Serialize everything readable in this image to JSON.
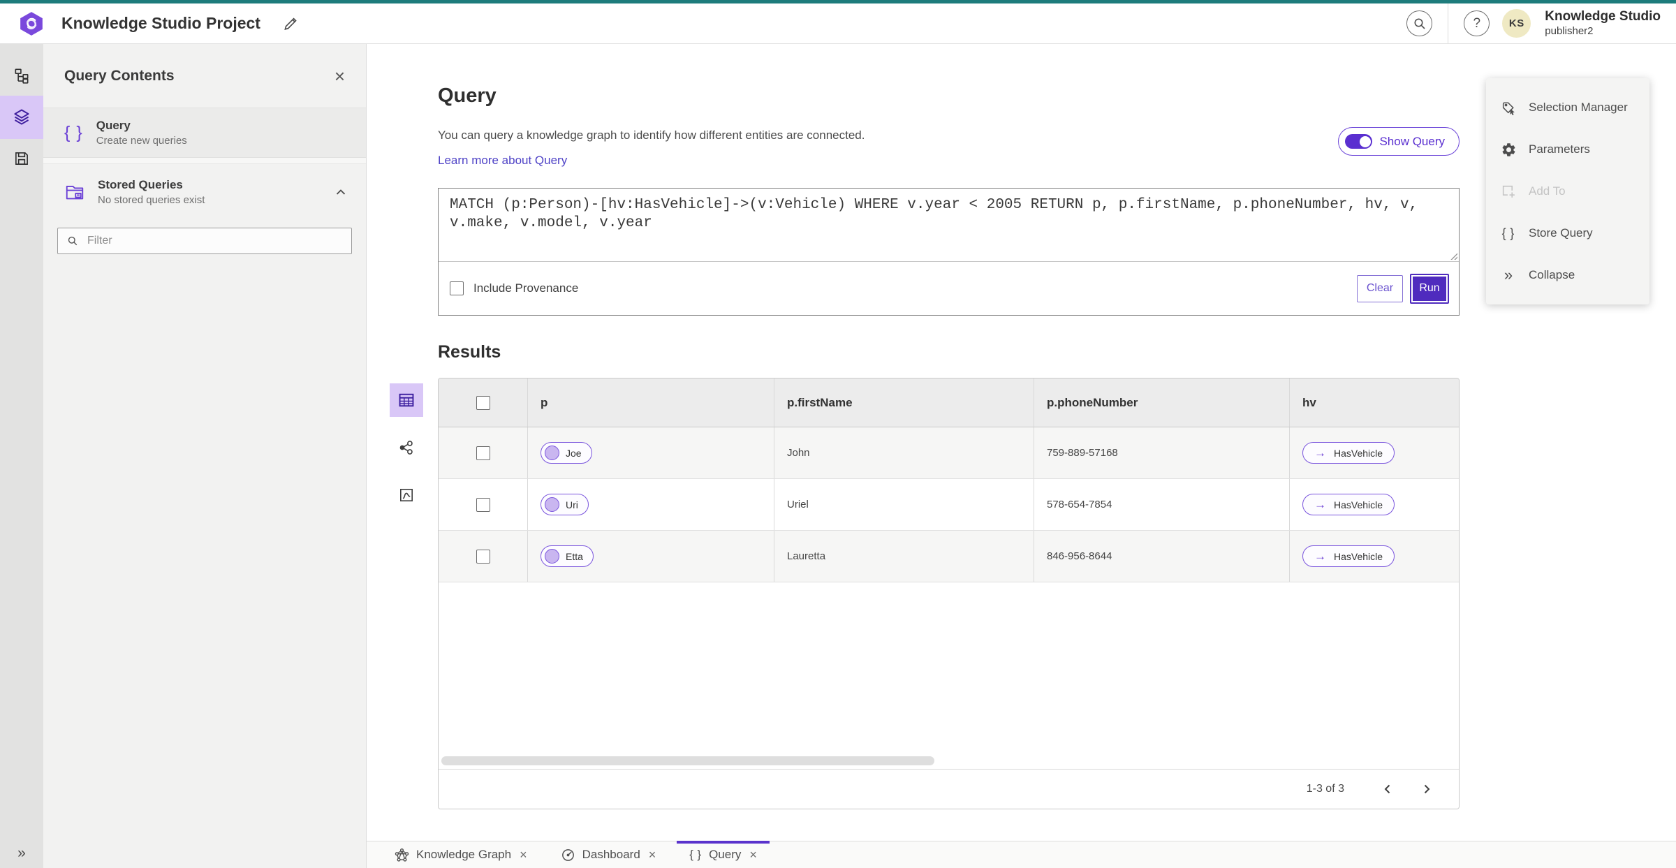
{
  "app": {
    "title": "Knowledge Studio Project",
    "avatar_initials": "KS",
    "account_name": "Knowledge Studio",
    "account_user": "publisher2"
  },
  "colors": {
    "top_accent": "#1e7c7c",
    "primary_purple": "#5a2fd0",
    "run_button": "#4f2bbe",
    "selected_icon_bg": "#d9c7f7",
    "link": "#4d41c6",
    "avatar_bg": "#efe9c3",
    "disabled_text": "#c4c4c4"
  },
  "icons": {
    "logo": "hexagon-swirl",
    "edit_title": "pencil",
    "search": "magnifier",
    "help": "question-mark-circle",
    "rail": [
      "hierarchy-scheme",
      "layers",
      "save-floppy",
      "double-chevron-expand"
    ],
    "panel_close": "x",
    "query_item": "curly-braces",
    "stored_queries": "folder-box",
    "filter": "magnifier",
    "view_switcher": [
      "table-view",
      "graph-view",
      "chart-view"
    ],
    "entity_cell": "node-circle",
    "relationship_cell": "arrow-right",
    "pagination": [
      "chevron-left",
      "chevron-right"
    ],
    "tab_icons": [
      "network-graph",
      "gauge",
      "curly-braces"
    ]
  },
  "left_panel": {
    "title": "Query Contents",
    "sections": [
      {
        "label": "Query",
        "subtitle": "Create new queries"
      },
      {
        "label": "Stored Queries",
        "subtitle": "No stored queries exist"
      }
    ],
    "filter_placeholder": "Filter"
  },
  "query": {
    "heading": "Query",
    "description": "You can query a knowledge graph to identify how different entities are connected.",
    "learn_more_label": "Learn more about Query",
    "show_query_label": "Show Query",
    "show_query_on": true,
    "query_text": "MATCH (p:Person)-[hv:HasVehicle]->(v:Vehicle) WHERE v.year < 2005 RETURN p, p.firstName, p.phoneNumber, hv, v, v.make, v.model, v.year",
    "include_provenance_label": "Include Provenance",
    "include_provenance_checked": false,
    "clear_label": "Clear",
    "run_label": "Run"
  },
  "results": {
    "heading": "Results",
    "columns": [
      "p",
      "p.firstName",
      "p.phoneNumber",
      "hv"
    ],
    "rows": [
      {
        "p": "Joe",
        "firstName": "John",
        "phone": "759-889-57168",
        "hv": "HasVehicle"
      },
      {
        "p": "Uri",
        "firstName": "Uriel",
        "phone": "578-654-7854",
        "hv": "HasVehicle"
      },
      {
        "p": "Etta",
        "firstName": "Lauretta",
        "phone": "846-956-8644",
        "hv": "HasVehicle"
      }
    ],
    "pagination_label": "1-3 of 3"
  },
  "right_panel": {
    "items": [
      {
        "label": "Selection Manager",
        "disabled": false
      },
      {
        "label": "Parameters",
        "disabled": false
      },
      {
        "label": "Add To",
        "disabled": true
      },
      {
        "label": "Store Query",
        "disabled": false
      },
      {
        "label": "Collapse",
        "disabled": false
      }
    ]
  },
  "tabs": [
    {
      "label": "Knowledge Graph",
      "active": false
    },
    {
      "label": "Dashboard",
      "active": false
    },
    {
      "label": "Query",
      "active": true
    }
  ]
}
